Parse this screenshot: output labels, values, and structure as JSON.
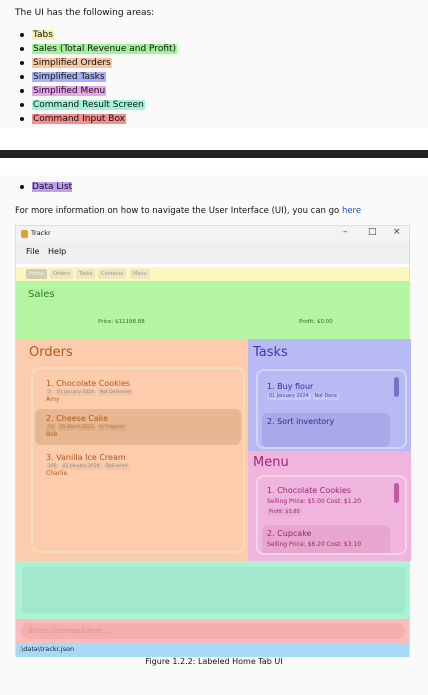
{
  "intro": "The UI has the following areas:",
  "legend": [
    {
      "label": "Tabs",
      "color": "#f7f2b0"
    },
    {
      "label": "Sales (Total Revenue and Profit)",
      "color": "#a2f29a"
    },
    {
      "label": "Simplified Orders",
      "color": "#f7c6a2"
    },
    {
      "label": "Simplified Tasks",
      "color": "#aab0f2"
    },
    {
      "label": "Simplified Menu",
      "color": "#e6a6e8"
    },
    {
      "label": "Command Result Screen",
      "color": "#a2f2d8"
    },
    {
      "label": "Command Input Box",
      "color": "#f28e8e"
    }
  ],
  "legend2": [
    {
      "label": "Data List",
      "color": "#c29bf2"
    }
  ],
  "info_text": "For more information on how to navigate the User Interface (UI), you can go ",
  "info_link": "here",
  "app": {
    "title": "Trackr",
    "window_controls": {
      "minimize": "–",
      "maximize": "□",
      "close": "×"
    },
    "menus": [
      "File",
      "Help"
    ],
    "tabs": [
      "Home",
      "Orders",
      "Tasks",
      "Contacts",
      "Menu"
    ],
    "sales": {
      "title": "Sales",
      "price": "Price: $11198.88",
      "profit": "Profit: $0.00"
    },
    "orders": {
      "title": "Orders",
      "items": [
        {
          "name": "1.  Chocolate Cookies",
          "qty": "3",
          "date": "01 January 2024",
          "status": "Not Delivered",
          "customer": "Amy"
        },
        {
          "name": "2.  Cheese Cake",
          "qty": "10",
          "date": "05 March 2024",
          "status": "In Progress",
          "customer": "Bob"
        },
        {
          "name": "3.  Vanilla Ice Cream",
          "qty": "100",
          "date": "02 January 2024",
          "status": "Delivered",
          "customer": "Charlie"
        }
      ]
    },
    "tasks": {
      "title": "Tasks",
      "items": [
        {
          "name": "1.  Buy flour",
          "date": "01 January 2024",
          "status": "Not Done"
        },
        {
          "name": "2.  Sort inventory",
          "date": "",
          "status": ""
        }
      ]
    },
    "menu": {
      "title": "Menu",
      "items": [
        {
          "name": "1.  Chocolate Cookies",
          "meta": "Selling Price: $5.00   Cost: $1.20",
          "profit": "Profit: $3.80"
        },
        {
          "name": "2.  Cupcake",
          "meta": "Selling Price: $6.20   Cost: $3.10",
          "profit": ""
        }
      ]
    },
    "command_placeholder": "Enter command here...",
    "status_path": ".\\data\\trackr.json"
  },
  "caption": "Figure 1.2.2: Labeled Home Tab UI"
}
